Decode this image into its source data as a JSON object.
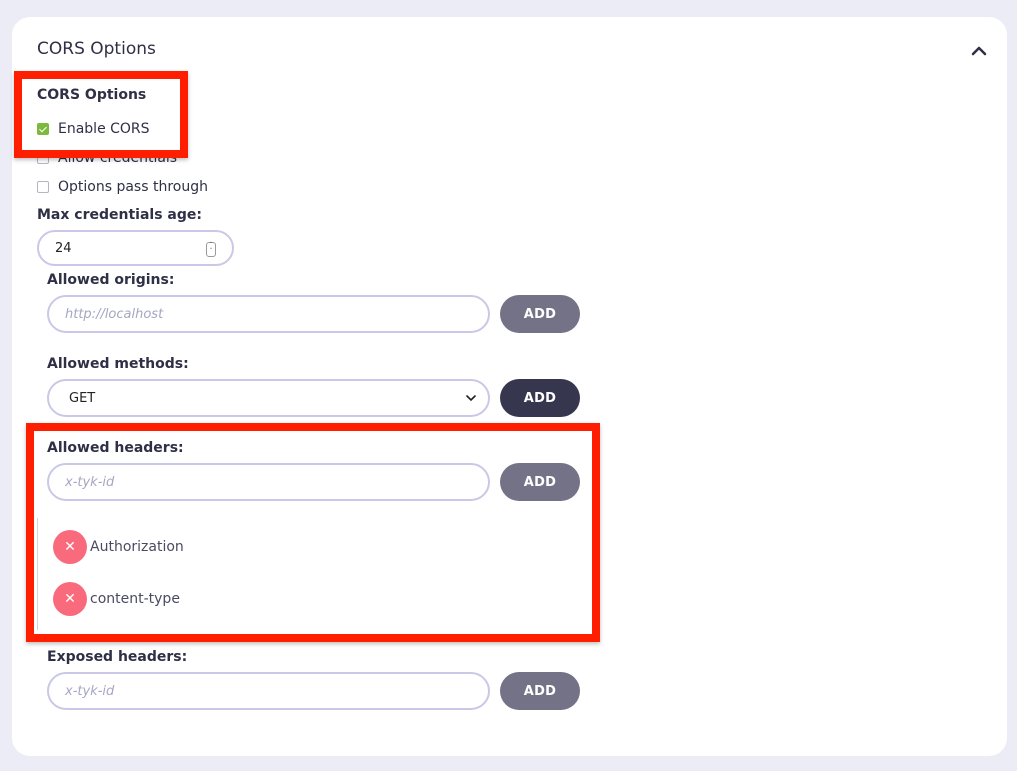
{
  "card": {
    "title": "CORS Options",
    "collapse_icon": "chevron-up-icon"
  },
  "section": {
    "title": "CORS Options"
  },
  "checkboxes": [
    {
      "label": "Enable CORS",
      "checked": true
    },
    {
      "label": "Allow credentials",
      "checked": false
    },
    {
      "label": "Options pass through",
      "checked": false
    }
  ],
  "max_age": {
    "label": "Max credentials age:",
    "value": "24"
  },
  "allowed_origins": {
    "label": "Allowed origins:",
    "placeholder": "http://localhost",
    "add_label": "ADD"
  },
  "allowed_methods": {
    "label": "Allowed methods:",
    "selected": "GET",
    "add_label": "ADD"
  },
  "allowed_headers": {
    "label": "Allowed headers:",
    "placeholder": "x-tyk-id",
    "add_label": "ADD",
    "items": [
      {
        "label": "Authorization",
        "remove_icon": "x-icon"
      },
      {
        "label": "content-type",
        "remove_icon": "x-icon"
      }
    ]
  },
  "exposed_headers": {
    "label": "Exposed headers:",
    "placeholder": "x-tyk-id",
    "add_label": "ADD"
  },
  "colors": {
    "page_bg": "#ececf7",
    "checkbox_checked": "#7db93e",
    "add_button": "#737286",
    "add_button_active": "#36364e",
    "remove_button": "#f96b7c",
    "highlight": "#ff1f00",
    "input_border": "#c9c8e6"
  }
}
